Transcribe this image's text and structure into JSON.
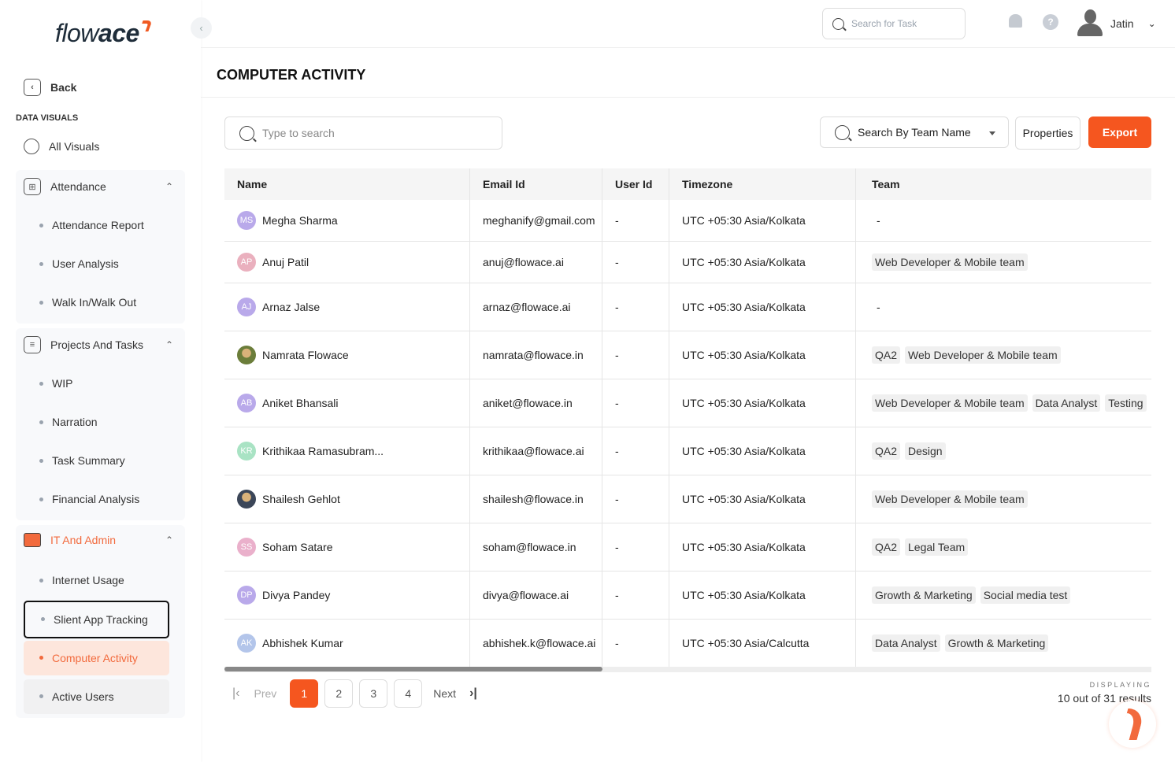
{
  "brand": {
    "name_light": "flow",
    "name_bold": "ace",
    "accent": "#f5561f"
  },
  "sidebar": {
    "back": "Back",
    "section": "DATA VISUALS",
    "all_visuals": "All Visuals",
    "groups": [
      {
        "label": "Attendance",
        "icon": "grid-icon",
        "items": [
          "Attendance Report",
          "User Analysis",
          "Walk In/Walk Out"
        ]
      },
      {
        "label": "Projects And Tasks",
        "icon": "clipboard-icon",
        "items": [
          "WIP",
          "Narration",
          "Task Summary",
          "Financial Analysis"
        ]
      },
      {
        "label": "IT And Admin",
        "icon": "monitor-icon",
        "items": [
          "Internet Usage",
          "Slient App Tracking",
          "Computer Activity",
          "Active Users"
        ]
      }
    ],
    "active_item": "Computer Activity"
  },
  "topbar": {
    "search_placeholder": "Search for Task",
    "help": "?",
    "user": "Jatin"
  },
  "page": {
    "title": "COMPUTER ACTIVITY",
    "search_placeholder": "Type to search",
    "team_search": "Search By Team Name",
    "properties": "Properties",
    "export": "Export"
  },
  "table": {
    "columns": [
      "Name",
      "Email Id",
      "User Id",
      "Timezone",
      "Team"
    ],
    "rows": [
      {
        "initials": "MS",
        "color": "#b9a9ea",
        "name": "Megha Sharma",
        "email": "meghanify@gmail.com",
        "user_id": "-",
        "tz": "UTC +05:30 Asia/Kolkata",
        "teams": [],
        "team_empty": "-"
      },
      {
        "initials": "AP",
        "color": "#eab0be",
        "name": "Anuj Patil",
        "email": "anuj@flowace.ai",
        "user_id": "-",
        "tz": "UTC +05:30 Asia/Kolkata",
        "teams": [
          "Web Developer & Mobile team"
        ]
      },
      {
        "initials": "AJ",
        "color": "#b9a9ea",
        "name": "Arnaz Jalse",
        "email": "arnaz@flowace.ai",
        "user_id": "-",
        "tz": "UTC +05:30 Asia/Kolkata",
        "teams": [],
        "team_empty": "-"
      },
      {
        "initials": "",
        "photo": true,
        "color": "#6b7d3a",
        "name": "Namrata Flowace",
        "email": "namrata@flowace.in",
        "user_id": "-",
        "tz": "UTC +05:30 Asia/Kolkata",
        "teams": [
          "QA2",
          "Web Developer & Mobile team"
        ]
      },
      {
        "initials": "AB",
        "color": "#b9a9ea",
        "name": "Aniket Bhansali",
        "email": "aniket@flowace.in",
        "user_id": "-",
        "tz": "UTC +05:30 Asia/Kolkata",
        "teams": [
          "Web Developer & Mobile team",
          "Data Analyst",
          "Testing"
        ]
      },
      {
        "initials": "KR",
        "color": "#a9e3c4",
        "name": "Krithikaa Ramasubram...",
        "email": "krithikaa@flowace.ai",
        "user_id": "-",
        "tz": "UTC +05:30 Asia/Kolkata",
        "teams": [
          "QA2",
          "Design"
        ]
      },
      {
        "initials": "",
        "photo": true,
        "color": "#3b4658",
        "name": "Shailesh Gehlot",
        "email": "shailesh@flowace.in",
        "user_id": "-",
        "tz": "UTC +05:30 Asia/Kolkata",
        "teams": [
          "Web Developer & Mobile team"
        ]
      },
      {
        "initials": "SS",
        "color": "#eab0cb",
        "name": "Soham Satare",
        "email": "soham@flowace.in",
        "user_id": "-",
        "tz": "UTC +05:30 Asia/Kolkata",
        "teams": [
          "QA2",
          "Legal Team"
        ]
      },
      {
        "initials": "DP",
        "color": "#b9a9ea",
        "name": "Divya Pandey",
        "email": "divya@flowace.ai",
        "user_id": "-",
        "tz": "UTC +05:30 Asia/Kolkata",
        "teams": [
          "Growth & Marketing",
          "Social media test"
        ]
      },
      {
        "initials": "AK",
        "color": "#b3c5ea",
        "name": "Abhishek Kumar",
        "email": "abhishek.k@flowace.ai",
        "user_id": "-",
        "tz": "UTC +05:30 Asia/Calcutta",
        "teams": [
          "Data Analyst",
          "Growth & Marketing"
        ]
      }
    ]
  },
  "pagination": {
    "prev": "Prev",
    "next": "Next",
    "pages": [
      "1",
      "2",
      "3",
      "4"
    ],
    "current": "1",
    "displaying_label": "DISPLAYING",
    "displaying": "10 out of 31 results"
  }
}
